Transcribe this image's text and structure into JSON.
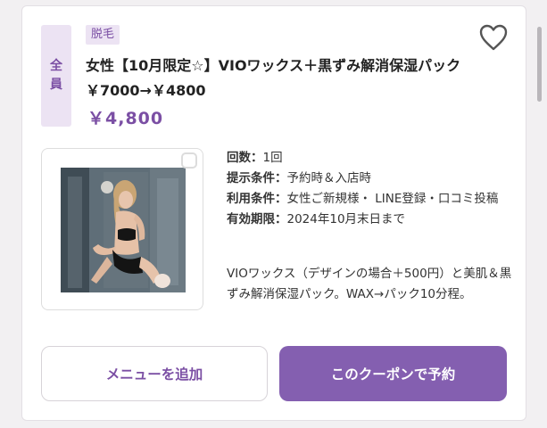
{
  "coupon": {
    "target_chars": [
      "全",
      "員"
    ],
    "category": "脱毛",
    "title": "女性【10月限定☆】VIOワックス＋黒ずみ解消保湿パック￥7000→￥4800",
    "price": "￥4,800",
    "details": [
      {
        "label": "回数：",
        "value": "1回"
      },
      {
        "label": "提示条件：",
        "value": "予約時＆入店時"
      },
      {
        "label": "利用条件：",
        "value": "女性ご新規様・ LINE登録・口コミ投稿"
      },
      {
        "label": "有効期限：",
        "value": "2024年10月末日まで"
      }
    ],
    "description": "VIOワックス（デザインの場合＋500円）と美肌＆黒ずみ解消保湿パック。WAX→パック10分程。",
    "buttons": {
      "add_menu": "メニューを追加",
      "reserve": "このクーポンで予約"
    }
  },
  "colors": {
    "accent": "#7b4fa4",
    "button": "#845fb0",
    "tag_bg": "#ece3f3"
  },
  "icons": {
    "favorite": "heart-icon",
    "photo_overlay": "photo-expand-icon"
  }
}
